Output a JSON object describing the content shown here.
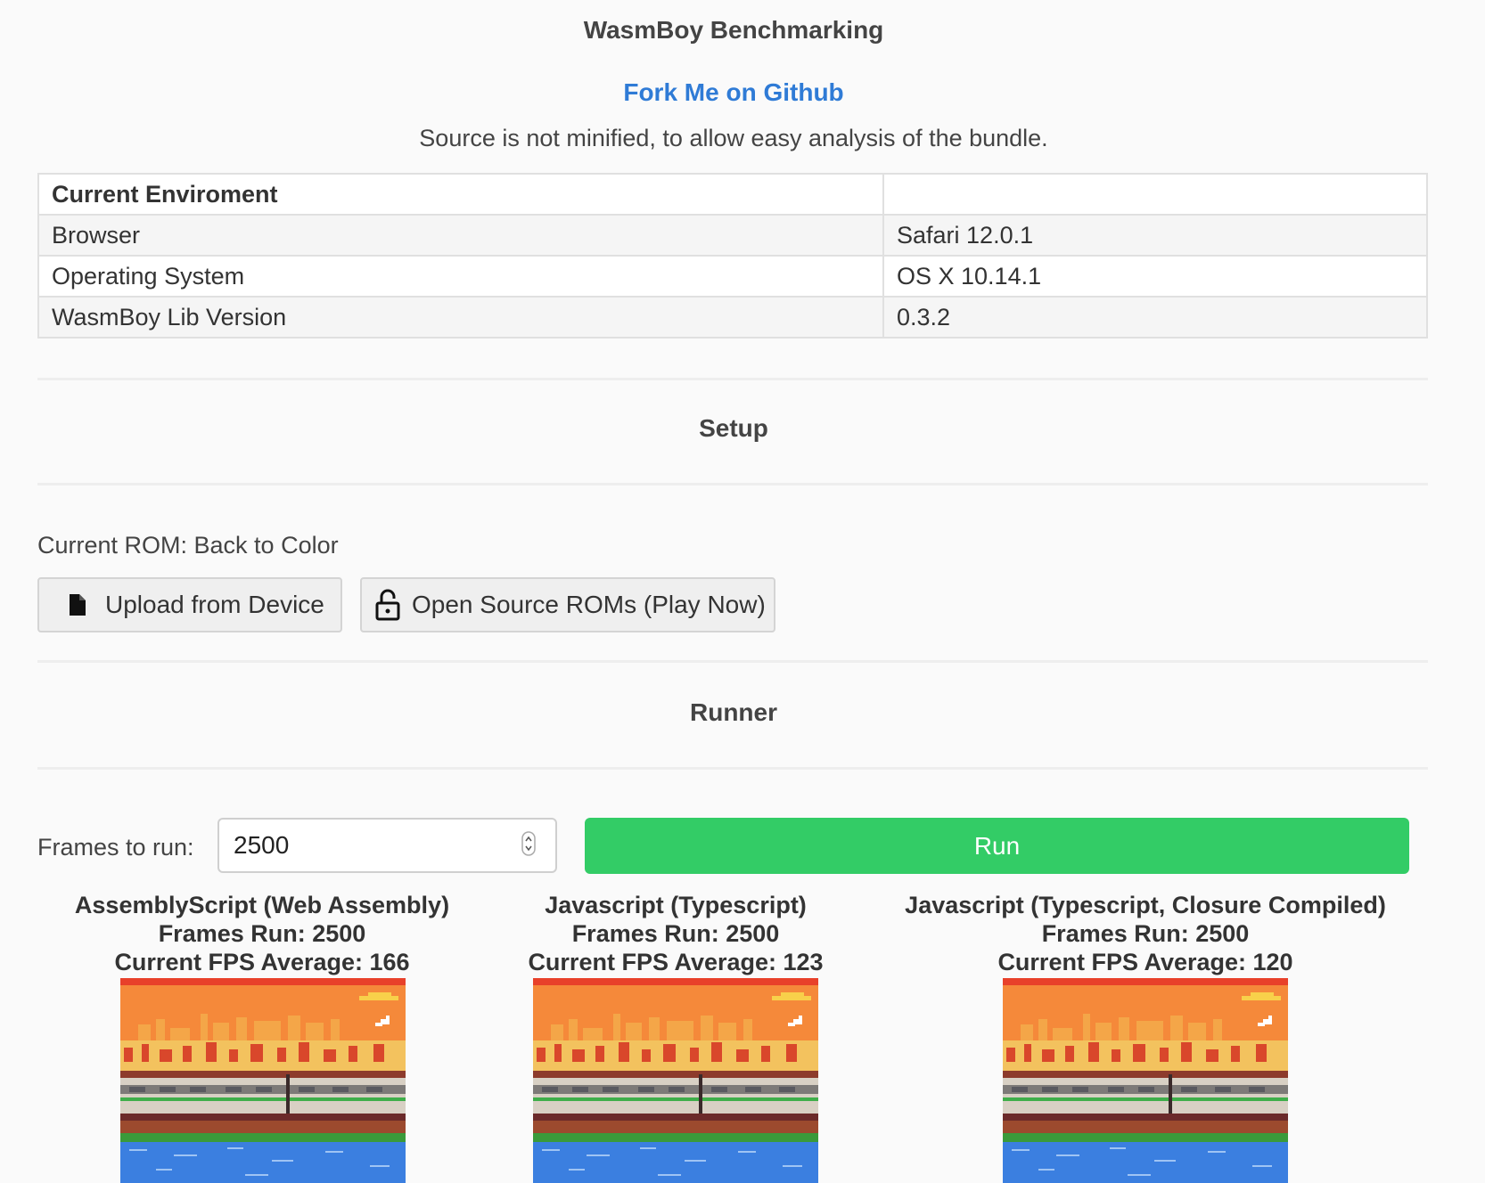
{
  "header": {
    "title": "WasmBoy Benchmarking",
    "fork_link": "Fork Me on Github",
    "source_note": "Source is not minified, to allow easy analysis of the bundle."
  },
  "environment": {
    "heading": "Current Enviroment",
    "rows": [
      {
        "label": "Browser",
        "value": "Safari 12.0.1"
      },
      {
        "label": "Operating System",
        "value": "OS X 10.14.1"
      },
      {
        "label": "WasmBoy Lib Version",
        "value": "0.3.2"
      }
    ]
  },
  "setup": {
    "title": "Setup",
    "current_rom": "Current ROM: Back to Color",
    "upload_button": "Upload from Device",
    "open_source_button": "Open Source ROMs (Play Now)",
    "upload_icon": "file-icon",
    "open_source_icon": "unlock-icon"
  },
  "runner": {
    "title": "Runner",
    "frames_label": "Frames to run:",
    "frames_value": "2500",
    "run_button": "Run",
    "run_color": "#33cc66"
  },
  "results": [
    {
      "name": "AssemblyScript (Web Assembly)",
      "frames": "Frames Run: 2500",
      "fps": "Current FPS Average: 166"
    },
    {
      "name": "Javascript (Typescript)",
      "frames": "Frames Run: 2500",
      "fps": "Current FPS Average: 123"
    },
    {
      "name": "Javascript (Typescript, Closure Compiled)",
      "frames": "Frames Run: 2500",
      "fps": "Current FPS Average: 120"
    }
  ]
}
